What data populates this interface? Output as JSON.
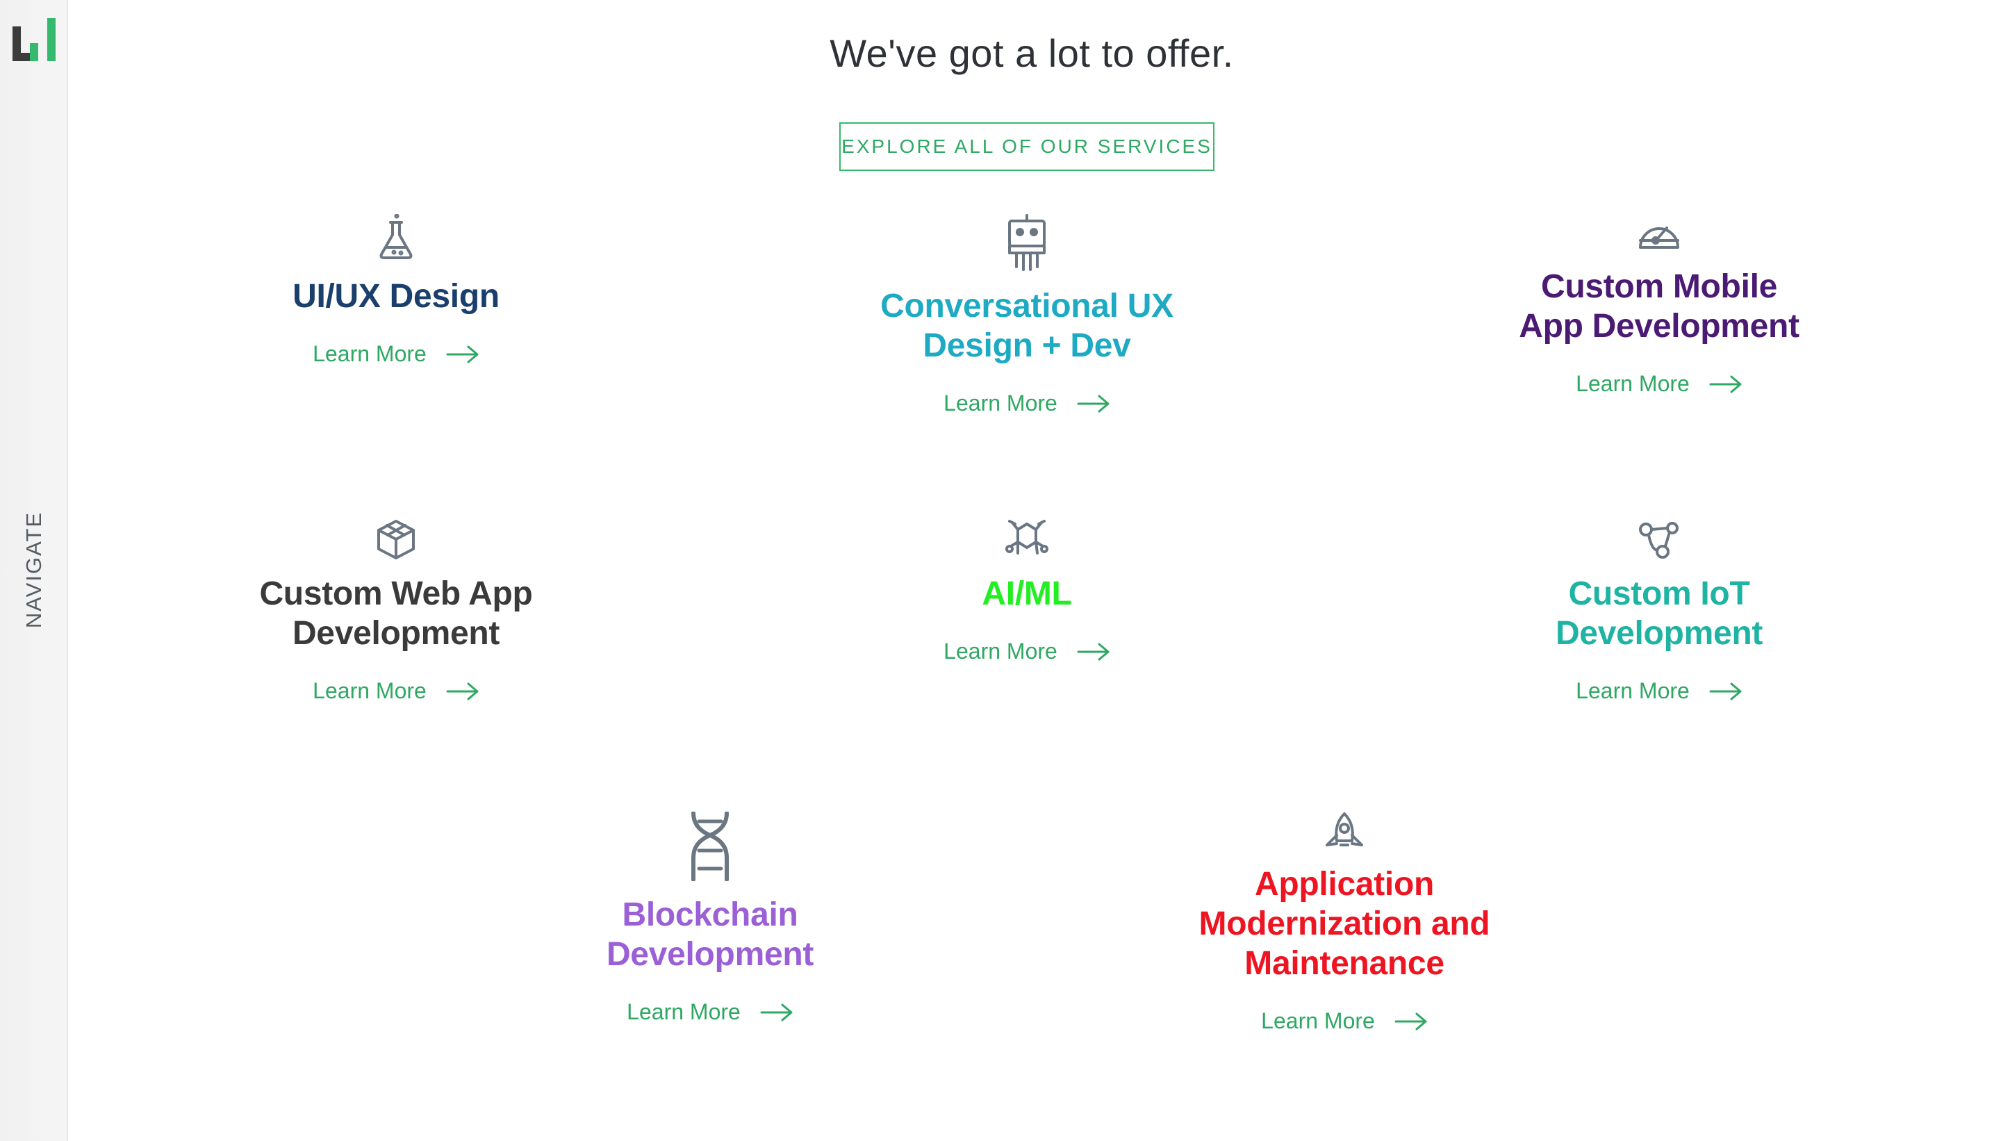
{
  "sidebar": {
    "nav_label": "NAVIGATE",
    "logo_colors": {
      "dark": "#3c3c3c",
      "green": "#34b96d"
    }
  },
  "header": {
    "title": "We've got a lot to offer.",
    "explore_button": "EXPLORE ALL OF OUR SERVICES"
  },
  "services": [
    {
      "title": "UI/UX Design",
      "color": "#1a3f6d",
      "icon": "flask-icon",
      "link": "Learn More"
    },
    {
      "title": "Conversational UX Design + Dev",
      "color": "#1faac3",
      "icon": "robot-icon",
      "link": "Learn More"
    },
    {
      "title": "Custom Mobile App Development",
      "color": "#4b1a72",
      "icon": "gauge-icon",
      "link": "Learn More"
    },
    {
      "title": "Custom Web App Development",
      "color": "#3a3a3a",
      "icon": "cube-icon",
      "link": "Learn More"
    },
    {
      "title": "AI/ML",
      "color": "#22ee22",
      "icon": "molecule-icon",
      "link": "Learn More"
    },
    {
      "title": "Custom IoT Development",
      "color": "#1fb3a4",
      "icon": "nodes-icon",
      "link": "Learn More"
    },
    {
      "title": "Blockchain Development",
      "color": "#9b5fd6",
      "icon": "dna-icon",
      "link": "Learn More"
    },
    {
      "title": "Application Modernization and Maintenance",
      "color": "#ee1522",
      "icon": "rocket-icon",
      "link": "Learn More"
    }
  ],
  "colors": {
    "accent_green": "#34b96d",
    "icon_gray": "#6b7683"
  }
}
